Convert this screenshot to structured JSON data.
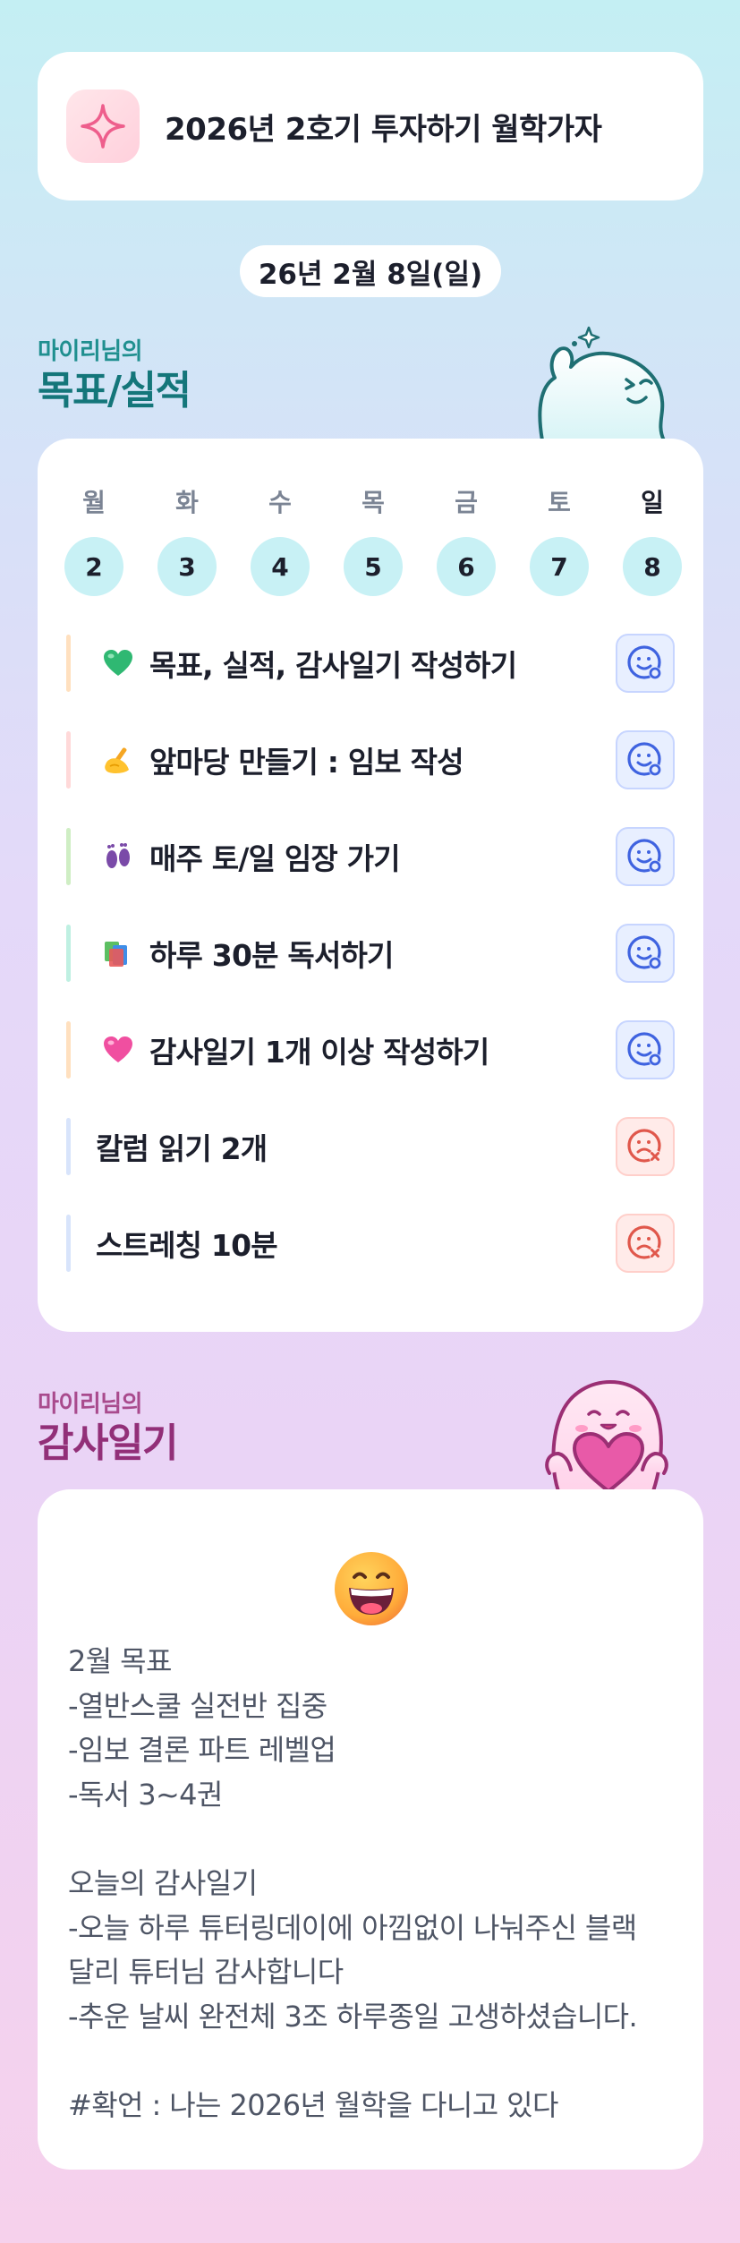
{
  "header": {
    "title": "2026년 2호기 투자하기 월학가자",
    "icon": "sparkle-icon"
  },
  "date": "26년 2월 8일(일)",
  "goals_section": {
    "subtitle": "마이리님의",
    "title": "목표/실적"
  },
  "days": [
    {
      "name": "월",
      "num": "2"
    },
    {
      "name": "화",
      "num": "3"
    },
    {
      "name": "수",
      "num": "4"
    },
    {
      "name": "목",
      "num": "5"
    },
    {
      "name": "금",
      "num": "6"
    },
    {
      "name": "토",
      "num": "7"
    },
    {
      "name": "일",
      "num": "8"
    }
  ],
  "goals": [
    {
      "icon": "green-heart-icon",
      "label": "목표, 실적, 감사일기 작성하기",
      "bar_color": "#ffe0bf",
      "status": "done"
    },
    {
      "icon": "writing-hand-icon",
      "label": "앞마당 만들기 : 임보 작성",
      "bar_color": "#ffd9d9",
      "status": "done"
    },
    {
      "icon": "footprints-icon",
      "label": "매주 토/일 임장 가기",
      "bar_color": "#cfeec4",
      "status": "done"
    },
    {
      "icon": "books-icon",
      "label": "하루 30분 독서하기",
      "bar_color": "#bff0e2",
      "status": "done"
    },
    {
      "icon": "pink-heart-icon",
      "label": "감사일기 1개 이상 작성하기",
      "bar_color": "#ffe0bf",
      "status": "done"
    },
    {
      "icon": "",
      "label": "칼럼 읽기 2개",
      "bar_color": "#d8e4fb",
      "status": "not-done"
    },
    {
      "icon": "",
      "label": "스트레칭 10분",
      "bar_color": "#d8e4fb",
      "status": "not-done"
    }
  ],
  "diary_section": {
    "subtitle": "마이리님의",
    "title": "감사일기"
  },
  "diary": {
    "emoji": "grinning-face-icon",
    "lines": [
      "2월 목표",
      "-열반스쿨 실전반 집중",
      "-임보 결론 파트 레벨업",
      "-독서 3~4권",
      "",
      "오늘의 감사일기",
      "-오늘 하루 튜터링데이에 아낌없이 나눠주신 블랙",
      "달리 튜터님 감사합니다",
      "-추운 날씨 완전체 3조 하루종일 고생하셨습니다.",
      "",
      "#확언 : 나는 2026년 월학을 다니고 있다"
    ]
  },
  "colors": {
    "done_icon": "#3f63e0",
    "not_done_icon": "#e0574b",
    "day_circle": "#c8f1f5"
  }
}
